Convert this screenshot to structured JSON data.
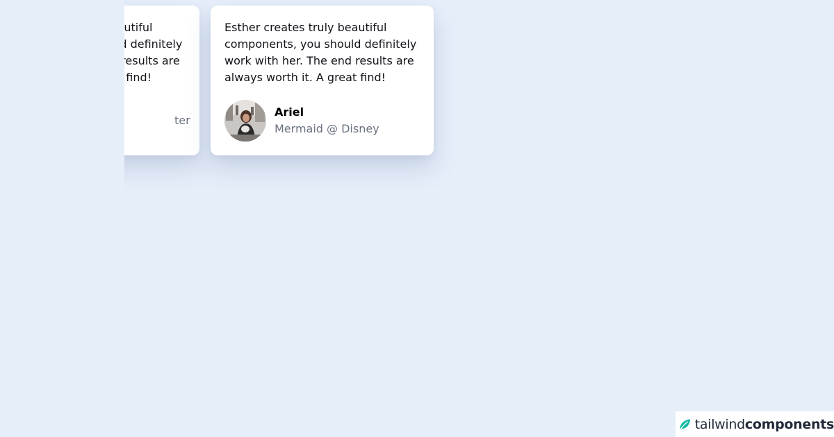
{
  "testimonials": [
    {
      "quote": "Esther creates truly beautiful components, you should definitely work with her. The end results are always worth it. A great find!",
      "name": "",
      "role": "ter"
    },
    {
      "quote": "Esther creates truly beautiful components, you should definitely work with her. The end results are always worth it. A great find!",
      "name": "Ariel",
      "role": "Mermaid @ Disney"
    }
  ],
  "brand": {
    "light": "tailwind",
    "bold": "components",
    "icon": "leaf-icon",
    "color": "#14b8a6"
  },
  "colors": {
    "background": "#e6eefa",
    "card": "#ffffff",
    "muted_text": "#6b7280"
  }
}
